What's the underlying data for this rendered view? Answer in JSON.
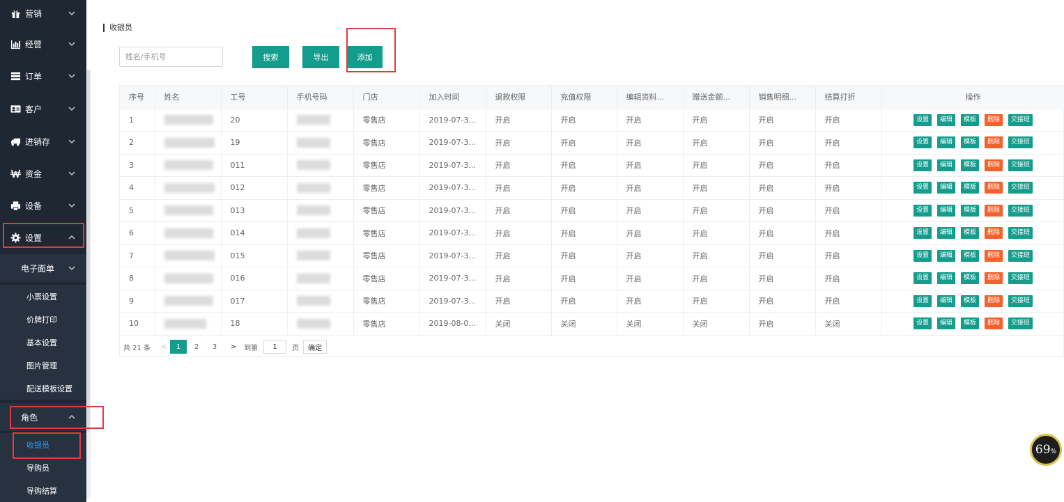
{
  "sidebar": {
    "items": [
      {
        "label": "营销",
        "icon": "gift-icon"
      },
      {
        "label": "经营",
        "icon": "bar-chart-icon"
      },
      {
        "label": "订单",
        "icon": "list-icon"
      },
      {
        "label": "客户",
        "icon": "id-card-icon"
      },
      {
        "label": "进销存",
        "icon": "truck-icon"
      },
      {
        "label": "资金",
        "icon": "won-icon"
      },
      {
        "label": "设备",
        "icon": "printer-icon"
      },
      {
        "label": "设置",
        "icon": "gear-icon"
      }
    ],
    "submenu_electronic": "电子面单",
    "electronic_items": [
      "小票设置",
      "价牌打印",
      "基本设置",
      "图片管理",
      "配送模板设置"
    ],
    "submenu_role": "角色",
    "role_items": [
      "收银员",
      "导购员",
      "导购结算"
    ],
    "active_item": "收银员"
  },
  "main": {
    "title": "收银员",
    "search_placeholder": "姓名/手机号",
    "buttons": {
      "search": "搜索",
      "export": "导出",
      "add": "添加"
    }
  },
  "table": {
    "headers": [
      "序号",
      "姓名",
      "工号",
      "手机号码",
      "门店",
      "加入时间",
      "退款权限",
      "充值权限",
      "编辑资料...",
      "赠送金额...",
      "销售明细...",
      "结算打折",
      "操作"
    ],
    "rows": [
      {
        "no": "1",
        "job": "20",
        "store": "零售店",
        "time": "2019-07-3...",
        "refund": "开启",
        "recharge": "开启",
        "edit": "开启",
        "gift": "开启",
        "detail": "开启",
        "discount": "开启"
      },
      {
        "no": "2",
        "job": "19",
        "store": "零售店",
        "time": "2019-07-3...",
        "refund": "开启",
        "recharge": "开启",
        "edit": "开启",
        "gift": "开启",
        "detail": "开启",
        "discount": "开启"
      },
      {
        "no": "3",
        "job": "011",
        "store": "零售店",
        "time": "2019-07-3...",
        "refund": "开启",
        "recharge": "开启",
        "edit": "开启",
        "gift": "开启",
        "detail": "开启",
        "discount": "开启"
      },
      {
        "no": "4",
        "job": "012",
        "store": "零售店",
        "time": "2019-07-3...",
        "refund": "开启",
        "recharge": "开启",
        "edit": "开启",
        "gift": "开启",
        "detail": "开启",
        "discount": "开启"
      },
      {
        "no": "5",
        "job": "013",
        "store": "零售店",
        "time": "2019-07-3...",
        "refund": "开启",
        "recharge": "开启",
        "edit": "开启",
        "gift": "开启",
        "detail": "开启",
        "discount": "开启"
      },
      {
        "no": "6",
        "job": "014",
        "store": "零售店",
        "time": "2019-07-3...",
        "refund": "开启",
        "recharge": "开启",
        "edit": "开启",
        "gift": "开启",
        "detail": "开启",
        "discount": "开启"
      },
      {
        "no": "7",
        "job": "015",
        "store": "零售店",
        "time": "2019-07-3...",
        "refund": "开启",
        "recharge": "开启",
        "edit": "开启",
        "gift": "开启",
        "detail": "开启",
        "discount": "开启"
      },
      {
        "no": "8",
        "job": "016",
        "store": "零售店",
        "time": "2019-07-3...",
        "refund": "开启",
        "recharge": "开启",
        "edit": "开启",
        "gift": "开启",
        "detail": "开启",
        "discount": "开启"
      },
      {
        "no": "9",
        "job": "017",
        "store": "零售店",
        "time": "2019-07-3...",
        "refund": "开启",
        "recharge": "开启",
        "edit": "开启",
        "gift": "开启",
        "detail": "开启",
        "discount": "开启"
      },
      {
        "no": "10",
        "job": "18",
        "store": "零售店",
        "time": "2019-08-0...",
        "refund": "关闭",
        "recharge": "关闭",
        "edit": "关闭",
        "gift": "关闭",
        "detail": "开启",
        "discount": "关闭"
      }
    ],
    "actions": {
      "set": "设置",
      "edit": "编辑",
      "template": "模板",
      "delete": "删除",
      "shift": "交接班"
    }
  },
  "pagination": {
    "total": "共 21 条",
    "pages": [
      "1",
      "2",
      "3"
    ],
    "current": "1",
    "goto_label": "到第",
    "goto_value": "1",
    "unit": "页",
    "confirm": "确定"
  },
  "badge": {
    "value": "69",
    "unit": "%"
  },
  "colors": {
    "sidebar_bg": "#1f2733",
    "primary": "#149c8c",
    "danger": "#f5612c",
    "highlight": "#e4393c",
    "active_link": "#2d9cf7"
  }
}
